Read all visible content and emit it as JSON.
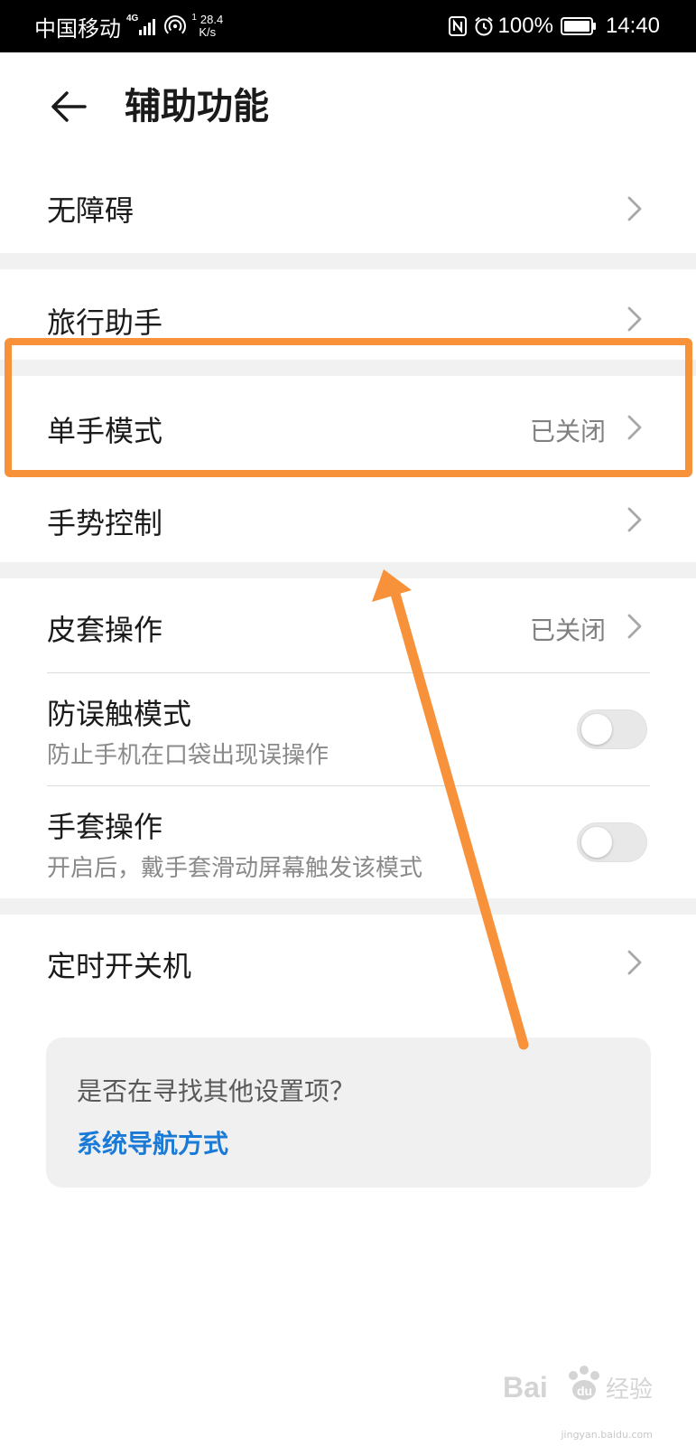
{
  "status_bar": {
    "carrier": "中国移动",
    "network_type": "4G",
    "hotspot_count": "1",
    "net_speed": "28.4",
    "net_speed_unit": "K/s",
    "battery": "100%",
    "time": "14:40"
  },
  "header": {
    "title": "辅助功能"
  },
  "items": {
    "accessibility": {
      "label": "无障碍"
    },
    "travel_assistant": {
      "label": "旅行助手"
    },
    "one_hand_mode": {
      "label": "单手模式",
      "value": "已关闭"
    },
    "gesture_control": {
      "label": "手势控制"
    },
    "flip_cover": {
      "label": "皮套操作",
      "value": "已关闭"
    },
    "accidental_touch": {
      "label": "防误触模式",
      "sub": "防止手机在口袋出现误操作",
      "enabled": false
    },
    "glove_mode": {
      "label": "手套操作",
      "sub": "开启后，戴手套滑动屏幕触发该模式",
      "enabled": false
    },
    "scheduled_power": {
      "label": "定时开关机"
    }
  },
  "suggestion": {
    "question": "是否在寻找其他设置项？",
    "link": "系统导航方式"
  },
  "annotation": {
    "color": "#f7913a"
  },
  "watermark": {
    "brand": "Bai du 经验",
    "site": "jingyan.baidu.com"
  },
  "colors": {
    "link": "#1a7ad6",
    "divider_gap": "#f1f1f1",
    "highlight": "#f7913a"
  }
}
